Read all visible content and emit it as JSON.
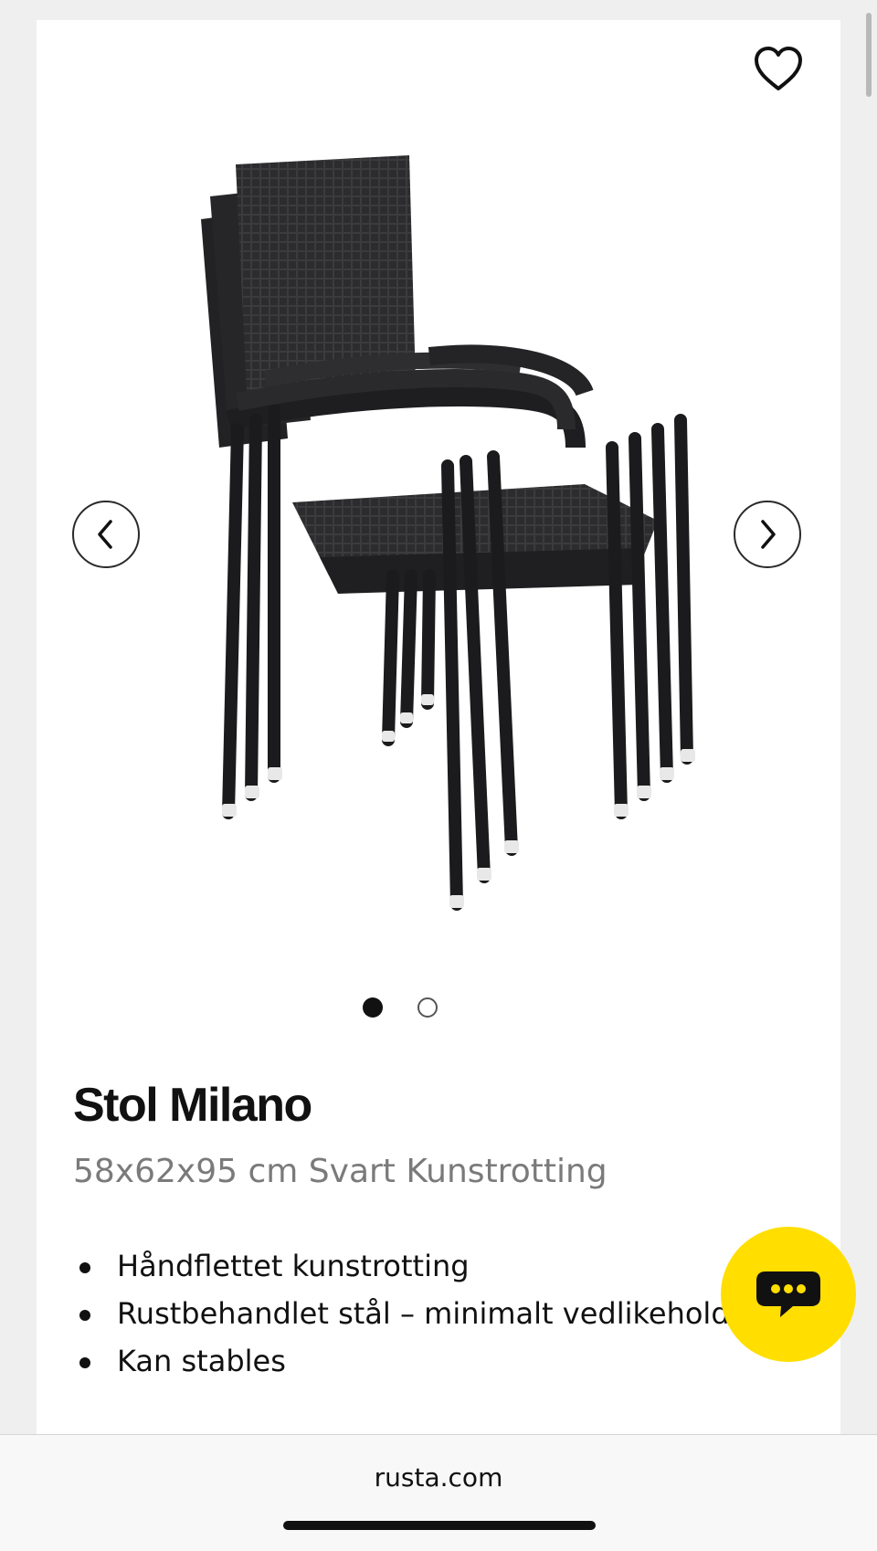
{
  "product": {
    "title": "Stol Milano",
    "subtitle": "58x62x95 cm Svart Kunstrotting",
    "features": [
      "Håndflettet kunstrotting",
      "Rustbehandlet stål – minimalt vedlikehold",
      "Kan stables"
    ]
  },
  "gallery": {
    "image_subject": "stacked black wicker chairs",
    "current_index": 1,
    "total_images": 2
  },
  "browser": {
    "url": "rusta.com"
  },
  "icons": {
    "favorite": "heart-icon",
    "prev": "chevron-left-icon",
    "next": "chevron-right-icon",
    "chat": "chat-bubble-icon"
  },
  "colors": {
    "chat_button": "#ffde00",
    "text_primary": "#111111",
    "text_secondary": "#7a7a7a"
  }
}
